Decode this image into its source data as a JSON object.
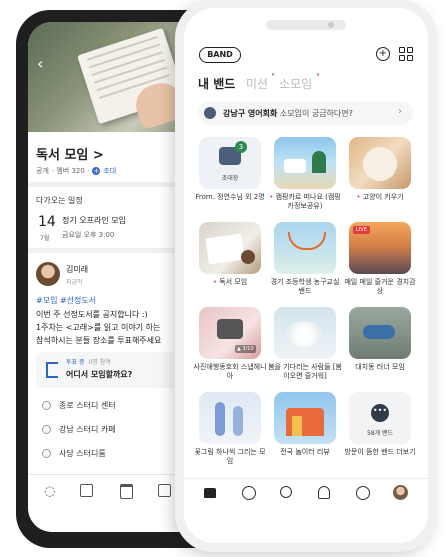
{
  "back": {
    "group_title": "독서 모임 >",
    "meta_public": "공개",
    "meta_members": "· 멤버 320 ·",
    "meta_invite": "초대",
    "section_schedule": "다가오는 일정",
    "event_day": "14",
    "event_month": "7월",
    "event_title": "정기 오프라인 모임",
    "event_time": "금요일 오후 3:00",
    "poster_name": "김미래",
    "poster_sub": "지금막",
    "post_tags": "#모임 #선정도서",
    "post_line1": "이번 주 선정도서를 공지합니다 :)",
    "post_line2": "1주차는 <고래>를 읽고 이야기 하는",
    "post_line3": "참석하시는 분들 장소를 투표해주세요",
    "vote_badge": "투표 중",
    "vote_count": "0명 참여",
    "vote_question": "어디서 모임할까요?",
    "vote_options": [
      "종로 스터디 센터",
      "강남 스터디 카페",
      "사당 스터디룸"
    ]
  },
  "front": {
    "logo": "BAND",
    "tab_my": "내 밴드",
    "tab_mission": "미션",
    "tab_moim": "소모임",
    "banner_place": "강남구 영어회화",
    "banner_text": "소모임이 궁금하다면?",
    "invite_badge": "3",
    "invite_label": "초대장",
    "cards": [
      {
        "label": "From. 정연수님 외 2명"
      },
      {
        "label": "캠핑카로 떠나요 (캠핑카정보공유)"
      },
      {
        "label": "고양이 키우기"
      },
      {
        "label": "독서 모임"
      },
      {
        "label": "경기 조등학생 농구교실 밴드"
      },
      {
        "label": "매일 매일 즐거운 경치감상"
      },
      {
        "label": "사진애행동호회 스냅헤니아"
      },
      {
        "label": "봄을 기다리는 사람들 [봄이오면 즐거워]"
      },
      {
        "label": "대치동 러너 모임"
      },
      {
        "label": "꽃그림 하나씩 그리는 모임"
      },
      {
        "label": "전국 놀이터 리뷰"
      },
      {
        "label": "방문이 뜸한 밴드 더보기"
      }
    ],
    "live_badge": "LIVE",
    "camera_count": "▲ 3/10",
    "more_bands": "58개 밴드"
  },
  "colors": {
    "accent": "#2d8a4e",
    "red": "#f04b3a",
    "blue": "#3d6bd4"
  }
}
